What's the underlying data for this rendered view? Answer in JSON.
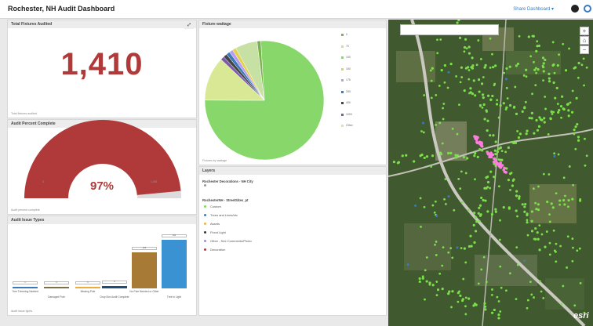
{
  "app": {
    "title": "Rochester, NH Audit Dashboard",
    "share_label": "Share Dashboard ▾"
  },
  "colors": {
    "accent": "#b03a3a",
    "gauge_track": "#dcdcdc",
    "map_points": "#7be04b",
    "map_highlight": "#ff7de0"
  },
  "panels": {
    "total": {
      "title": "Total Fixtures Audited",
      "value": "1,410",
      "footer": "Total fixtures audited"
    },
    "audit": {
      "title": "Audit Percent Complete",
      "value_label": "97%",
      "progress": 0.97,
      "min_label": "0",
      "max_label": "1,451",
      "footer": "Audit percent complete"
    },
    "issue": {
      "title": "Audit Issue Types",
      "footer": "Audit issue types"
    },
    "wattage": {
      "title": "Fixture wattage",
      "footer": "Fixtures by wattage"
    },
    "layers": {
      "title": "Layers",
      "sections": [
        {
          "name": "Rochester Decorations - NH City",
          "items": [
            {
              "label": ""
            }
          ]
        },
        {
          "name": "RochesterNH - StreetSites_pt",
          "items": [
            {
              "label": "Custom",
              "color": "#7be04b"
            },
            {
              "label": "Trees and Lines/etc",
              "color": "#3a7bbf"
            },
            {
              "label": "Assets",
              "color": "#e8b54a"
            },
            {
              "label": "Flood Light",
              "color": "#333333"
            },
            {
              "label": "Other - See Comments/Photo",
              "color": "#9b8fd2"
            },
            {
              "label": "Decoration",
              "color": "#b03a3a"
            }
          ]
        }
      ]
    }
  },
  "chart_data": [
    {
      "type": "bar",
      "title": "Audit Issue Types",
      "categories": [
        "Tree Trimming Needed",
        "Damaged Pole",
        "Missing Pole",
        "Drop Box Audit Complete",
        "No Pole Needed or Other",
        "Tree in Light"
      ],
      "values": [
        1,
        4,
        6,
        9,
        120,
        162
      ],
      "ylim": [
        0,
        162
      ],
      "colors": [
        "#3b79b8",
        "#7f6e4a",
        "#f0a93b",
        "#1d4c7a",
        "#a77a36",
        "#3b92d2"
      ]
    },
    {
      "type": "pie",
      "title": "Fixture wattage",
      "slices": [
        {
          "label": "0",
          "value": 1
        },
        {
          "label": "70",
          "value": 6
        },
        {
          "label": "100",
          "value": 76
        },
        {
          "label": "150",
          "value": 1
        },
        {
          "label": "175",
          "value": 1
        },
        {
          "label": "250",
          "value": 1
        },
        {
          "label": "400",
          "value": 1
        },
        {
          "label": "1000",
          "value": 1
        },
        {
          "label": "Other",
          "value": 12
        }
      ],
      "colors": [
        "#7ab34e",
        "#c7e0a4",
        "#87d76b",
        "#e3d24a",
        "#b79ef1",
        "#3b79b8",
        "#444444",
        "#7b5aa9",
        "#d9e895"
      ]
    }
  ]
}
